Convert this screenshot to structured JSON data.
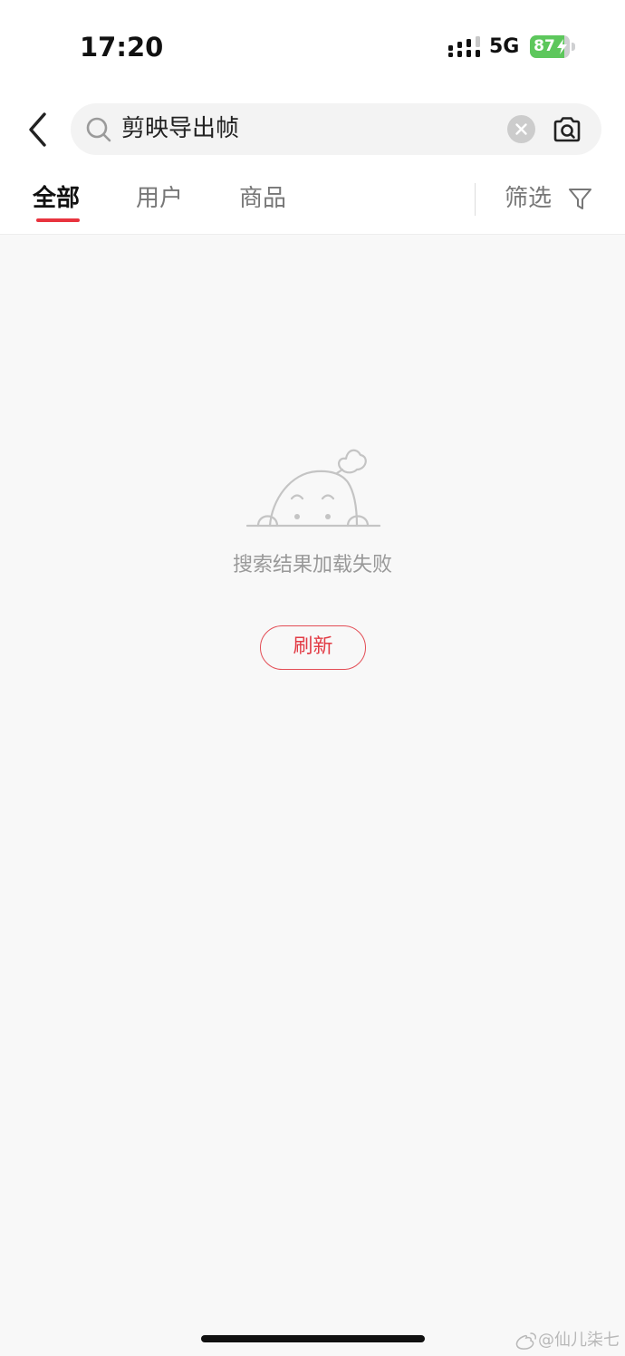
{
  "status_bar": {
    "time": "17:20",
    "network": "5G",
    "battery_level": "87",
    "battery_fraction": 0.87,
    "battery_color": "#5dc75c"
  },
  "search": {
    "query": "剪映导出帧",
    "icons": [
      "back-arrow-icon",
      "search-icon",
      "clear-icon",
      "camera-icon"
    ]
  },
  "tabs": [
    {
      "label": "全部",
      "active": true
    },
    {
      "label": "用户",
      "active": false
    },
    {
      "label": "商品",
      "active": false
    }
  ],
  "filter": {
    "label": "筛选",
    "icon": "filter-funnel-icon"
  },
  "empty_state": {
    "message": "搜索结果加载失败",
    "refresh_label": "刷新",
    "accent_color": "#e23b45"
  },
  "watermark": {
    "text": "@仙儿柒七",
    "icon": "weibo-icon"
  }
}
